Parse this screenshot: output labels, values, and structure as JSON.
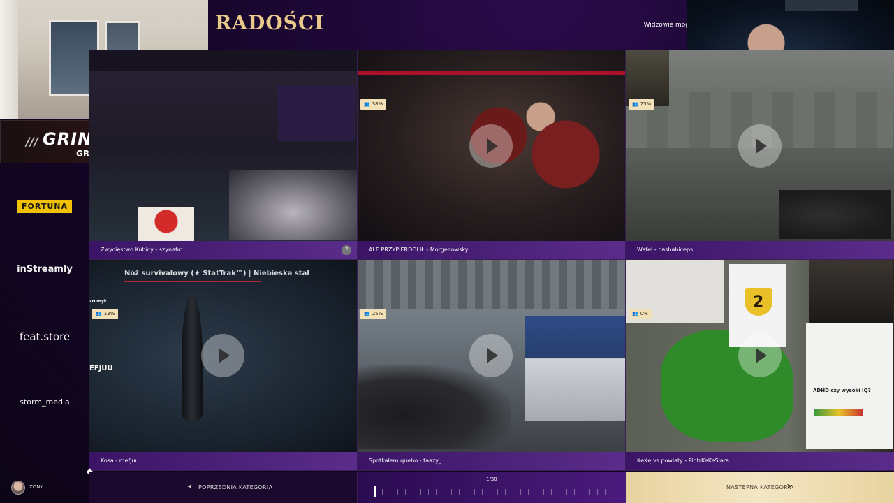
{
  "header": {
    "title": "RADOŚCI",
    "viewers_text": "Widzowie mog"
  },
  "branding": {
    "logo_text": "GRIND'G",
    "url": "GRINDG.PRO"
  },
  "sponsors": {
    "fortuna": "FORTUNA",
    "instreamly": "inStreamly",
    "feat": "feat.store",
    "storm": "storm_media"
  },
  "tiles": [
    {
      "caption": "Zwycięstwo Kubicy - szynafm",
      "percent": "",
      "help": "?"
    },
    {
      "caption": "ALE PRZYPIERDOLIŁ - Morgenowsky",
      "percent": "38%"
    },
    {
      "caption": "Wafel - pashabiceps",
      "percent": "25%"
    },
    {
      "caption": "Kosa - mefjuu",
      "percent": "13%",
      "skin_title": "Nóż survivalowy (★ StatTrak™) | Niebieska stal",
      "tag_small": "zrumyk",
      "tag_big": "EFJUU"
    },
    {
      "caption": "Spotkałem quebo - taazy_",
      "percent": "25%"
    },
    {
      "caption": "KęKę vs powiaty - PiotrKeKeSiara",
      "percent": "0%",
      "number": "2",
      "adhd_text": "ADHD czy wysoki IQ?"
    }
  ],
  "footer": {
    "user_name": "ZONY",
    "prev_label": "POPRZEDNIA KATEGORIA",
    "page_count": "1/30",
    "next_label": "NASTĘPNA KATEGORIA"
  },
  "colors": {
    "accent_gold": "#e9c98a",
    "caption_purple": "#4a1f7a",
    "badge_bg": "#f2e1b8"
  },
  "icons": {
    "percent_badge": "group-icon",
    "play": "play-icon",
    "prev": "arrow-left-icon",
    "next": "arrow-right-icon"
  }
}
